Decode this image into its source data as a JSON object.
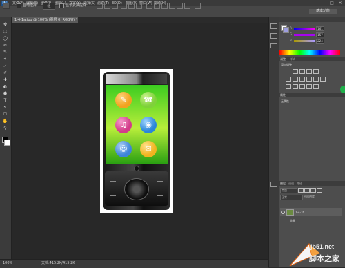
{
  "app": {
    "logo_text": "Ps"
  },
  "menu": [
    "文件(F)",
    "编辑(E)",
    "图像(I)",
    "图层(L)",
    "文字(Y)",
    "选择(S)",
    "滤镜(T)",
    "3D(D)",
    "视图(V)",
    "窗口(W)",
    "帮助(H)"
  ],
  "window_controls": {
    "minimize": "–",
    "maximize": "□",
    "close": "×"
  },
  "options_bar": {
    "auto_select_label": "自动选择",
    "auto_select_value": "组",
    "show_transform_label": "显示变换控件",
    "workspace_button": "基本功能"
  },
  "document": {
    "tab_title": "1-4-1a.jpg @ 100% (图层 0, RGB/8) * ×"
  },
  "status_bar": {
    "zoom": "100%",
    "doc_size": "文档:415.2K/415.2K"
  },
  "color_panel": {
    "values": [
      "161",
      "157",
      "224"
    ],
    "channels": [
      "R",
      "G",
      "B"
    ]
  },
  "adjustments_panel": {
    "tab1": "调整",
    "tab2": "样式",
    "title": "添加调整"
  },
  "properties_panel": {
    "tab": "属性",
    "text": "无属性"
  },
  "layers_panel": {
    "tab1": "图层",
    "tab2": "通道",
    "tab3": "路径",
    "kind_label": "类型",
    "blend": "正常",
    "opacity_label": "不透明度",
    "layers": [
      {
        "name": "1-4-1b"
      },
      {
        "name": "效果"
      }
    ]
  },
  "watermark": {
    "site": "jb51.net",
    "name": "脚本之家"
  },
  "colors": {
    "screen_green": "#3bcc20",
    "panel_bg": "#4d4d4d",
    "canvas_bg": "#282828",
    "bubble_green": "#1fb04a"
  },
  "phone_app_icons": [
    {
      "icon": "tools-icon",
      "glyph": "✎",
      "color": "#f3a21f"
    },
    {
      "icon": "contacts-icon",
      "glyph": "☎",
      "color": "#7fd13a"
    },
    {
      "icon": "music-icon",
      "glyph": "♫",
      "color": "#d23c8a"
    },
    {
      "icon": "globe-icon",
      "glyph": "◉",
      "color": "#2b86d9"
    },
    {
      "icon": "person-icon",
      "glyph": "☺",
      "color": "#3e84d8"
    },
    {
      "icon": "gift-icon",
      "glyph": "✉",
      "color": "#f2b31f"
    }
  ],
  "tools": [
    "✥",
    "⬚",
    "◯",
    "✂",
    "✎",
    "⌖",
    "⟋",
    "✐",
    "✚",
    "◐",
    "⬢",
    "T",
    "↖",
    "☐",
    "✋",
    "⚲"
  ]
}
